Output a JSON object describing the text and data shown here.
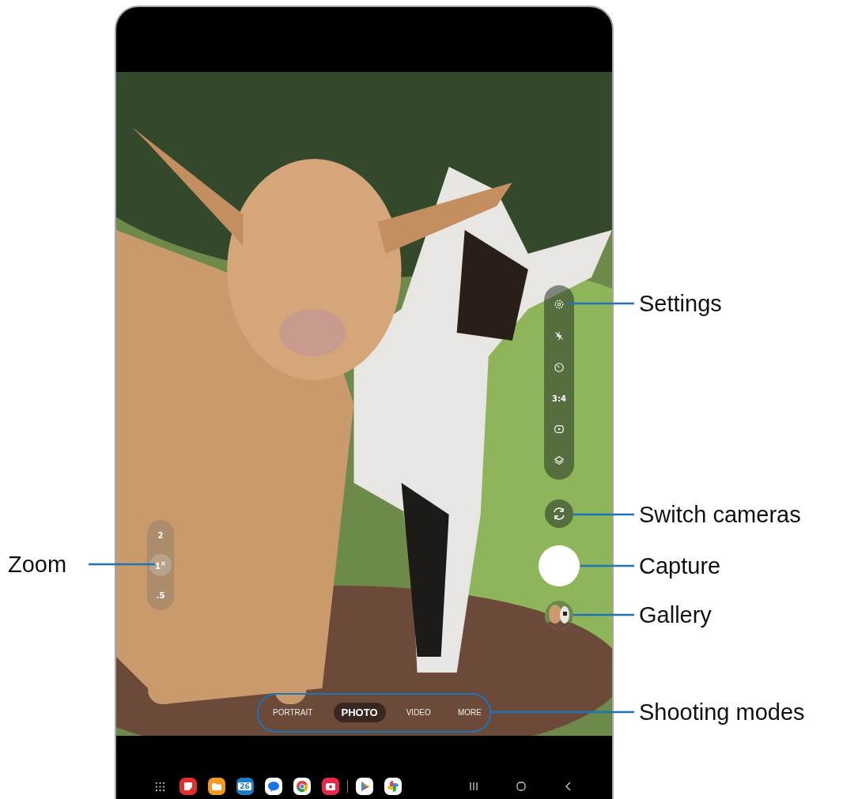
{
  "camera": {
    "settings_bar": [
      {
        "kind": "settings"
      },
      {
        "kind": "flash-off"
      },
      {
        "kind": "timer"
      },
      {
        "kind": "ratio",
        "text": "3:4"
      },
      {
        "kind": "motion"
      },
      {
        "kind": "filters"
      }
    ],
    "zoom_levels": [
      {
        "label": "2",
        "selected": false
      },
      {
        "label": "1$^{×}$",
        "selected": true
      },
      {
        "label": ".5",
        "selected": false
      }
    ],
    "modes": [
      {
        "label": "PORTRAIT",
        "selected": false
      },
      {
        "label": "PHOTO",
        "selected": true
      },
      {
        "label": "VIDEO",
        "selected": false
      },
      {
        "label": "MORE",
        "selected": false
      }
    ]
  },
  "taskbar": {
    "apps": [
      {
        "kind": "apps"
      },
      {
        "kind": "notes"
      },
      {
        "kind": "files"
      },
      {
        "kind": "calendar",
        "text": "26"
      },
      {
        "kind": "messages"
      },
      {
        "kind": "browser"
      },
      {
        "kind": "camera"
      },
      {
        "kind": "divider"
      },
      {
        "kind": "store"
      },
      {
        "kind": "photos"
      }
    ],
    "nav": [
      {
        "kind": "recents"
      },
      {
        "kind": "home"
      },
      {
        "kind": "back"
      }
    ]
  },
  "callouts": [
    {
      "kind": "settings",
      "label": "Settings"
    },
    {
      "kind": "switch",
      "label": "Switch cameras"
    },
    {
      "kind": "zoom",
      "label": "Zoom"
    },
    {
      "kind": "capture",
      "label": "Capture"
    },
    {
      "kind": "gallery",
      "label": "Gallery"
    },
    {
      "kind": "modes",
      "label": "Shooting modes"
    }
  ]
}
